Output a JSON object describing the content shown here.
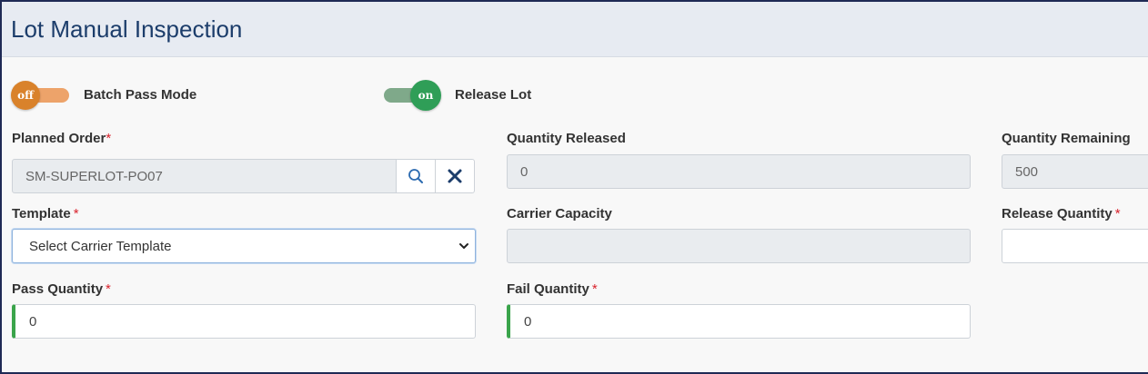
{
  "header": {
    "title": "Lot Manual Inspection"
  },
  "toggles": {
    "batch_pass": {
      "state_text": "off",
      "label": "Batch Pass Mode",
      "on": false
    },
    "release_lot": {
      "state_text": "on",
      "label": "Release Lot",
      "on": true
    }
  },
  "fields": {
    "planned_order": {
      "label": "Planned Order",
      "required": "*",
      "value": "SM-SUPERLOT-PO07"
    },
    "quantity_released": {
      "label": "Quantity Released",
      "value": "0"
    },
    "quantity_remaining": {
      "label": "Quantity Remaining",
      "value": "500"
    },
    "template": {
      "label": "Template",
      "required": "*",
      "selected": "Select Carrier Template"
    },
    "carrier_capacity": {
      "label": "Carrier Capacity",
      "value": ""
    },
    "release_quantity": {
      "label": "Release Quantity",
      "required": "*",
      "value": ""
    },
    "pass_quantity": {
      "label": "Pass Quantity",
      "required": "*",
      "value": "0"
    },
    "fail_quantity": {
      "label": "Fail Quantity",
      "required": "*",
      "value": "0"
    }
  },
  "icons": {
    "search": "search-icon",
    "clear": "close-icon",
    "dropdown": "chevron-down-icon"
  },
  "colors": {
    "title": "#1c3d6b",
    "toggle_off_knob": "#d9822b",
    "toggle_off_track": "#eda36a",
    "toggle_on_knob": "#2f9e57",
    "toggle_on_track": "#7fa98a",
    "required": "#d9232d",
    "valid_border": "#3aa44b"
  }
}
